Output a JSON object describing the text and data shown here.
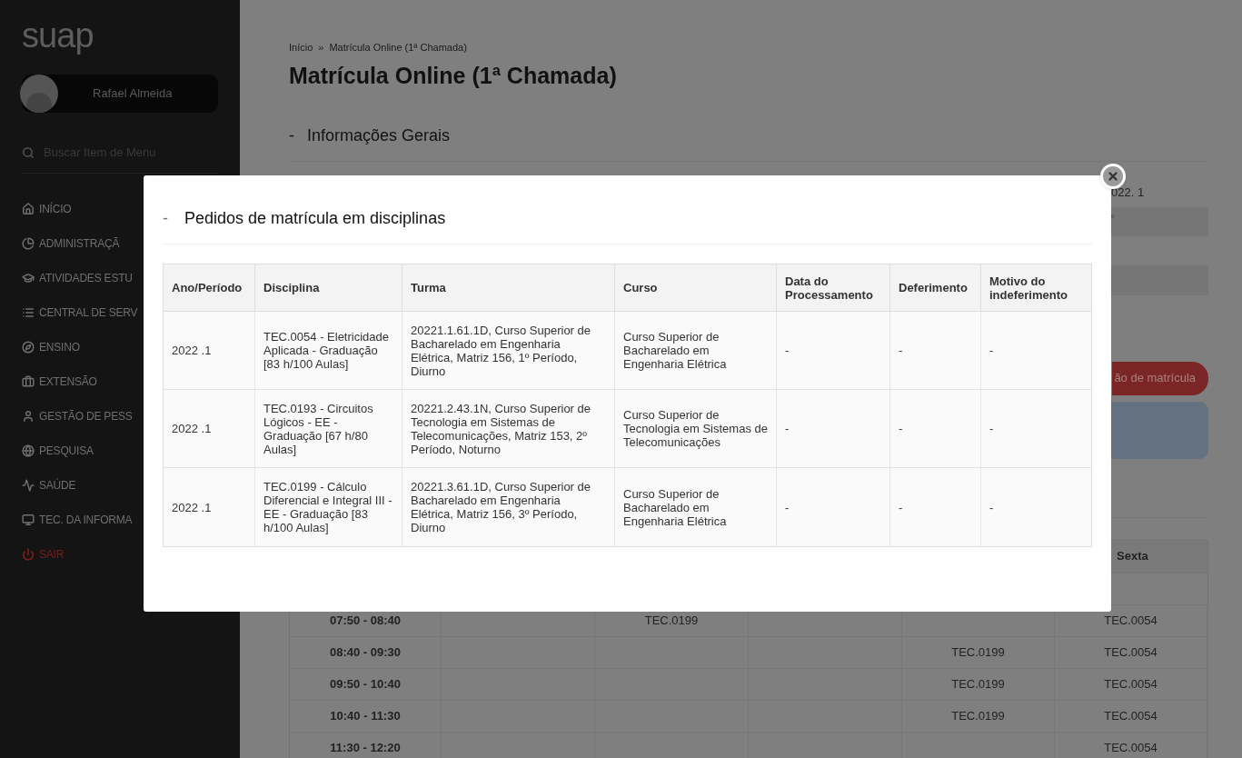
{
  "sidebar": {
    "logo": "suap",
    "user": {
      "name": "Rafael Almeida"
    },
    "search": {
      "placeholder": "Buscar Item de Menu"
    },
    "items": [
      {
        "kind": "home",
        "label": "INÍCIO"
      },
      {
        "kind": "chart",
        "label": "ADMINISTRAÇÃ"
      },
      {
        "kind": "cap",
        "label": "ATIVIDADES ESTU"
      },
      {
        "kind": "list",
        "label": "CENTRAL DE SERV"
      },
      {
        "kind": "compass",
        "label": "ENSINO"
      },
      {
        "kind": "briefcase",
        "label": "EXTENSÃO"
      },
      {
        "kind": "user",
        "label": "GESTÃO DE PESS"
      },
      {
        "kind": "globe",
        "label": "PESQUISA"
      },
      {
        "kind": "health",
        "label": "SAÚDE"
      },
      {
        "kind": "monitor",
        "label": "TEC. DA INFORMA"
      },
      {
        "kind": "logout",
        "label": "SAIR"
      }
    ]
  },
  "breadcrumb": [
    "Início",
    "Matrícula Online (1ª Chamada)"
  ],
  "breadcrumb_separator": "»",
  "title": "Matrícula Online (1ª Chamada)",
  "section_marker": "-",
  "section": "Informações Gerais",
  "background": {
    "period_value": "022. 1",
    "small_mark": "º",
    "action_button": "ão de matrícula",
    "schedule": {
      "header": "Sexta",
      "rows": [
        {
          "time": "07:50 - 08:40",
          "cells": [
            "",
            "TEC.0199",
            "",
            "",
            "TEC.0054"
          ]
        },
        {
          "time": "08:40 - 09:30",
          "cells": [
            "",
            "",
            "",
            "TEC.0199",
            "TEC.0054"
          ]
        },
        {
          "time": "09:50 - 10:40",
          "cells": [
            "",
            "",
            "",
            "TEC.0199",
            "TEC.0054"
          ]
        },
        {
          "time": "10:40 - 11:30",
          "cells": [
            "",
            "",
            "",
            "TEC.0199",
            "TEC.0054"
          ]
        },
        {
          "time": "11:30 - 12:20",
          "cells": [
            "",
            "",
            "",
            "",
            "TEC.0054"
          ]
        }
      ]
    }
  },
  "modal": {
    "marker": "-",
    "title": "Pedidos de matrícula em disciplinas",
    "columns": [
      "Ano/Período",
      "Disciplina",
      "Turma",
      "Curso",
      "Data do Processamento",
      "Deferimento",
      "Motivo do indeferimento"
    ],
    "rows": [
      [
        "2022 .1",
        "TEC.0054 - Eletricidade Aplicada - Graduação [83 h/100 Aulas]",
        "20221.1.61.1D, Curso Superior de Bacharelado em Engenharia Elétrica, Matriz 156, 1º Período, Diurno",
        "Curso Superior de Bacharelado em Engenharia Elétrica",
        "-",
        "-",
        "-"
      ],
      [
        "2022 .1",
        "TEC.0193 - Circuitos Lógicos - EE - Graduação [67 h/80 Aulas]",
        "20221.2.43.1N, Curso Superior de Tecnologia em Sistemas de Telecomunicações, Matriz 153, 2º Período, Noturno",
        "Curso Superior de Tecnologia em Sistemas de Telecomunicações",
        "-",
        "-",
        "-"
      ],
      [
        "2022 .1",
        "TEC.0199 - Cálculo Diferencial e Integral III - EE - Graduação [83 h/100 Aulas]",
        "20221.3.61.1D, Curso Superior de Bacharelado em Engenharia Elétrica, Matriz 156, 3º Período, Diurno",
        "Curso Superior de Bacharelado em Engenharia Elétrica",
        "-",
        "-",
        "-"
      ]
    ]
  }
}
